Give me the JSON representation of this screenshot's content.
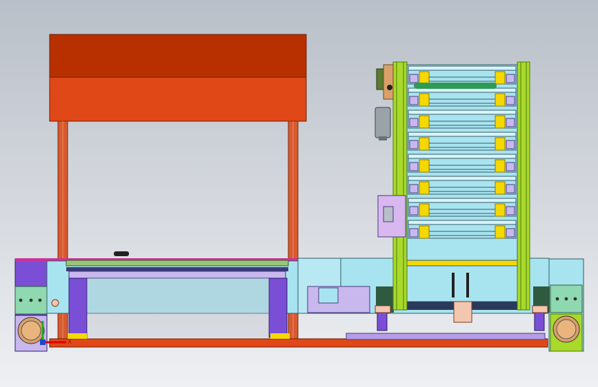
{
  "viewport": {
    "background_top": "#b9bfc8",
    "background_bottom": "#eef0f3"
  },
  "triad": {
    "x_label": "X"
  },
  "colors": {
    "roof_top": "#b83000",
    "roof_bottom": "#e04818",
    "post": "#d85a30",
    "purple": "#7a4fd6",
    "magenta": "#cc3399",
    "light_purple": "#c8b8ee",
    "mint": "#8fd9b0",
    "sky": "#a8e4f0",
    "lime": "#a9d92a",
    "lime_dark": "#4c7a10",
    "peach": "#f3c6b0",
    "tan": "#d9a06a",
    "olive": "#9bc57a",
    "navy": "#3a3a7a",
    "violet_plate": "#b59ee6",
    "yellow": "#f5d800",
    "green_roller": "#2f9a55",
    "grey_motor": "#9aa4a8"
  },
  "counts": {
    "rack_tiers": 8
  }
}
